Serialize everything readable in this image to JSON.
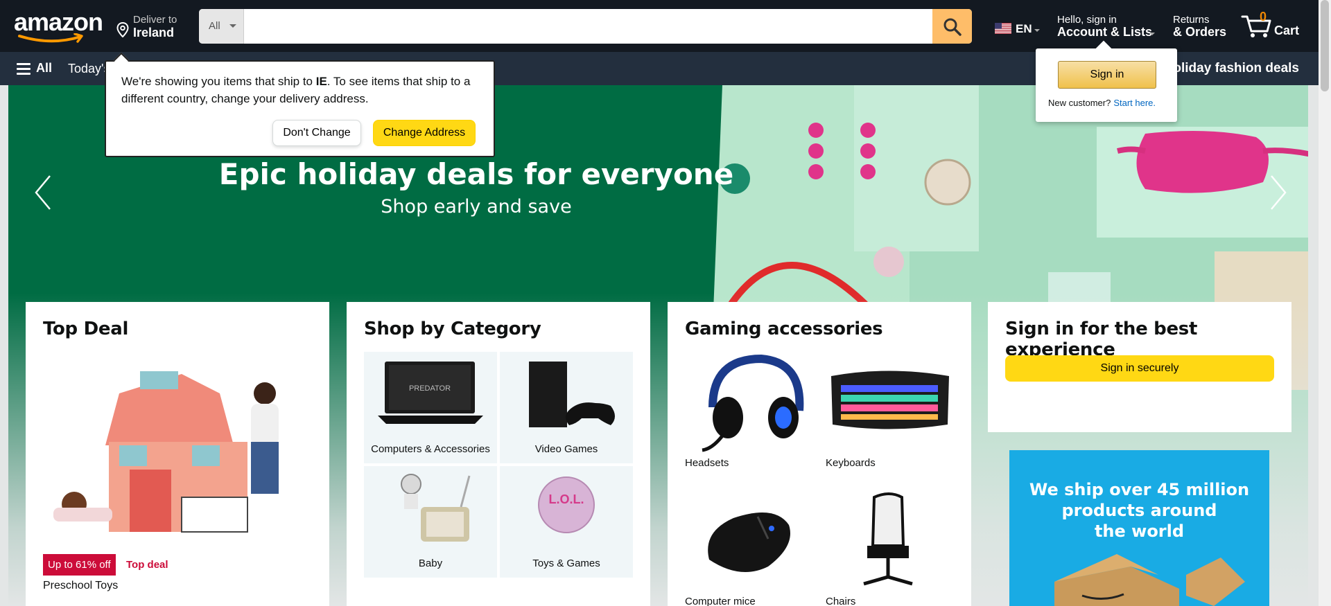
{
  "header": {
    "logo_text": "amazon",
    "deliver_line1": "Deliver to",
    "deliver_line2": "Ireland",
    "search_category": "All",
    "search_placeholder": "",
    "language": "EN",
    "account_line1": "Hello, sign in",
    "account_line2": "Account & Lists",
    "returns_line1": "Returns",
    "returns_line2": "& Orders",
    "cart_count": "0",
    "cart_label": "Cart"
  },
  "subnav": {
    "all_label": "All",
    "today_label": "Today's",
    "promo_label": "holiday fashion deals"
  },
  "hero": {
    "title": "Epic holiday deals for everyone",
    "subtitle": "Shop early and save"
  },
  "cards": {
    "top_deal": {
      "title": "Top Deal",
      "badge": "Up to 61% off",
      "tag": "Top deal",
      "name": "Preschool Toys"
    },
    "shop_category": {
      "title": "Shop by Category",
      "items": [
        {
          "label": "Computers & Accessories"
        },
        {
          "label": "Video Games"
        },
        {
          "label": "Baby"
        },
        {
          "label": "Toys & Games"
        }
      ]
    },
    "gaming": {
      "title": "Gaming accessories",
      "items": [
        {
          "label": "Headsets"
        },
        {
          "label": "Keyboards"
        },
        {
          "label": "Computer mice"
        },
        {
          "label": "Chairs"
        }
      ]
    },
    "signin": {
      "title": "Sign in for the best experience",
      "button": "Sign in securely"
    }
  },
  "ship_banner": {
    "line1": "We ship over 45 million",
    "line2": "products around",
    "line3": "the world"
  },
  "delivery_popover": {
    "msg_part1": "We're showing you items that ship to ",
    "msg_country": "IE",
    "msg_part2": ". To see items that ship to a different country, change your delivery address.",
    "dont_change": "Don't Change",
    "change_address": "Change Address"
  },
  "signin_flyout": {
    "button": "Sign in",
    "new_customer": "New customer?",
    "start_here": "Start here."
  },
  "colors": {
    "nav_dark": "#131921",
    "nav_sub": "#232f3e",
    "hero_green": "#006c43",
    "search_button": "#febd69",
    "primary_button": "#ffd814",
    "deal_red": "#cc0c39",
    "banner_blue": "#19abe4"
  }
}
